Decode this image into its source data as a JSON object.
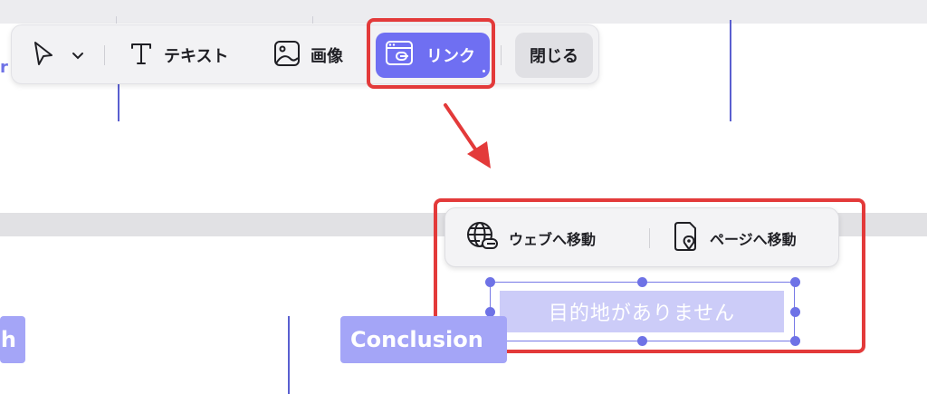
{
  "toolbar": {
    "text_label": "テキスト",
    "image_label": "画像",
    "link_label": "リンク",
    "close_label": "閉じる"
  },
  "popover": {
    "web_label": "ウェブへ移動",
    "page_label": "ページへ移動"
  },
  "link_field": {
    "placeholder": "目的地がありません"
  },
  "canvas": {
    "edge_letter": "r",
    "left_chip": "h",
    "conclusion_chip": "Conclusion"
  },
  "colors": {
    "accent": "#6f6ff2",
    "highlight_red": "#e33a3a",
    "toolbar_bg": "#f2f2f4",
    "guide_line": "#5a5fd0",
    "chip_bg": "#a4a5f7"
  },
  "icons": [
    "cursor-arrow-icon",
    "chevron-down-icon",
    "text-tool-icon",
    "image-icon",
    "link-window-icon",
    "globe-link-icon",
    "page-location-icon",
    "red-arrow-icon"
  ]
}
